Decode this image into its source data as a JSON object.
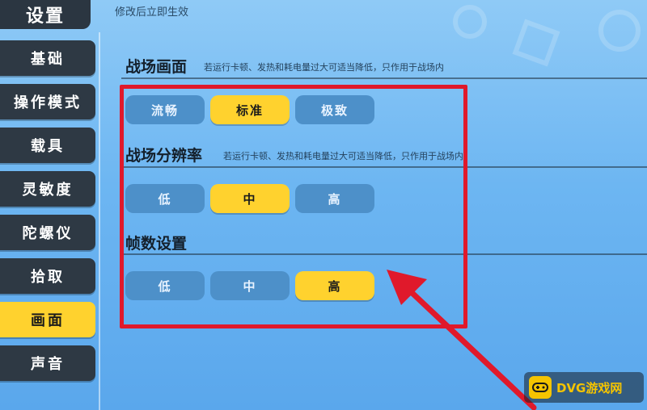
{
  "header": {
    "title": "设置",
    "subtitle": "修改后立即生效"
  },
  "sidebar": {
    "items": [
      {
        "label": "基础",
        "active": false
      },
      {
        "label": "操作模式",
        "active": false
      },
      {
        "label": "载具",
        "active": false
      },
      {
        "label": "灵敏度",
        "active": false
      },
      {
        "label": "陀螺仪",
        "active": false
      },
      {
        "label": "拾取",
        "active": false
      },
      {
        "label": "画面",
        "active": true
      },
      {
        "label": "声音",
        "active": false
      }
    ]
  },
  "sections": [
    {
      "title": "战场画面",
      "note": "若运行卡顿、发热和耗电量过大可适当降低，只作用于战场内",
      "options": [
        "流畅",
        "标准",
        "极致"
      ],
      "selected": "标准"
    },
    {
      "title": "战场分辨率",
      "note": "若运行卡顿、发热和耗电量过大可适当降低，只作用于战场内",
      "options": [
        "低",
        "中",
        "高"
      ],
      "selected": "中"
    },
    {
      "title": "帧数设置",
      "note": "",
      "options": [
        "低",
        "中",
        "高"
      ],
      "selected": "高"
    }
  ],
  "watermark": {
    "text": "DVG游戏网",
    "icon": "gamepad-icon"
  },
  "colors": {
    "selected": "#ffd22e",
    "unselected": "#4d90c9",
    "sidebar": "#2e3944",
    "highlight_box": "#e0192b"
  }
}
